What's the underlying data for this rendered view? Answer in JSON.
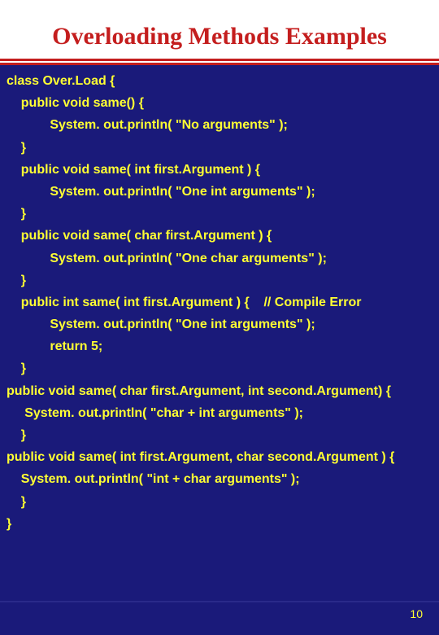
{
  "title": "Overloading Methods  Examples",
  "code_lines": [
    "class Over.Load {",
    "    public void same() {",
    "            System. out.println( \"No arguments\" );",
    "    }",
    "    public void same( int first.Argument ) {",
    "            System. out.println( \"One int arguments\" );",
    "    }",
    "    public void same( char first.Argument ) {",
    "            System. out.println( \"One char arguments\" );",
    "    }",
    "    public int same( int first.Argument ) {    // Compile Error",
    "            System. out.println( \"One int arguments\" );",
    "            return 5;",
    "    }",
    "public void same( char first.Argument, int second.Argument) {",
    "     System. out.println( \"char + int arguments\" );",
    "    }",
    "public void same( int first.Argument, char second.Argument ) {",
    "    System. out.println( \"int + char arguments\" );",
    "    }",
    "}"
  ],
  "page_number": "10"
}
